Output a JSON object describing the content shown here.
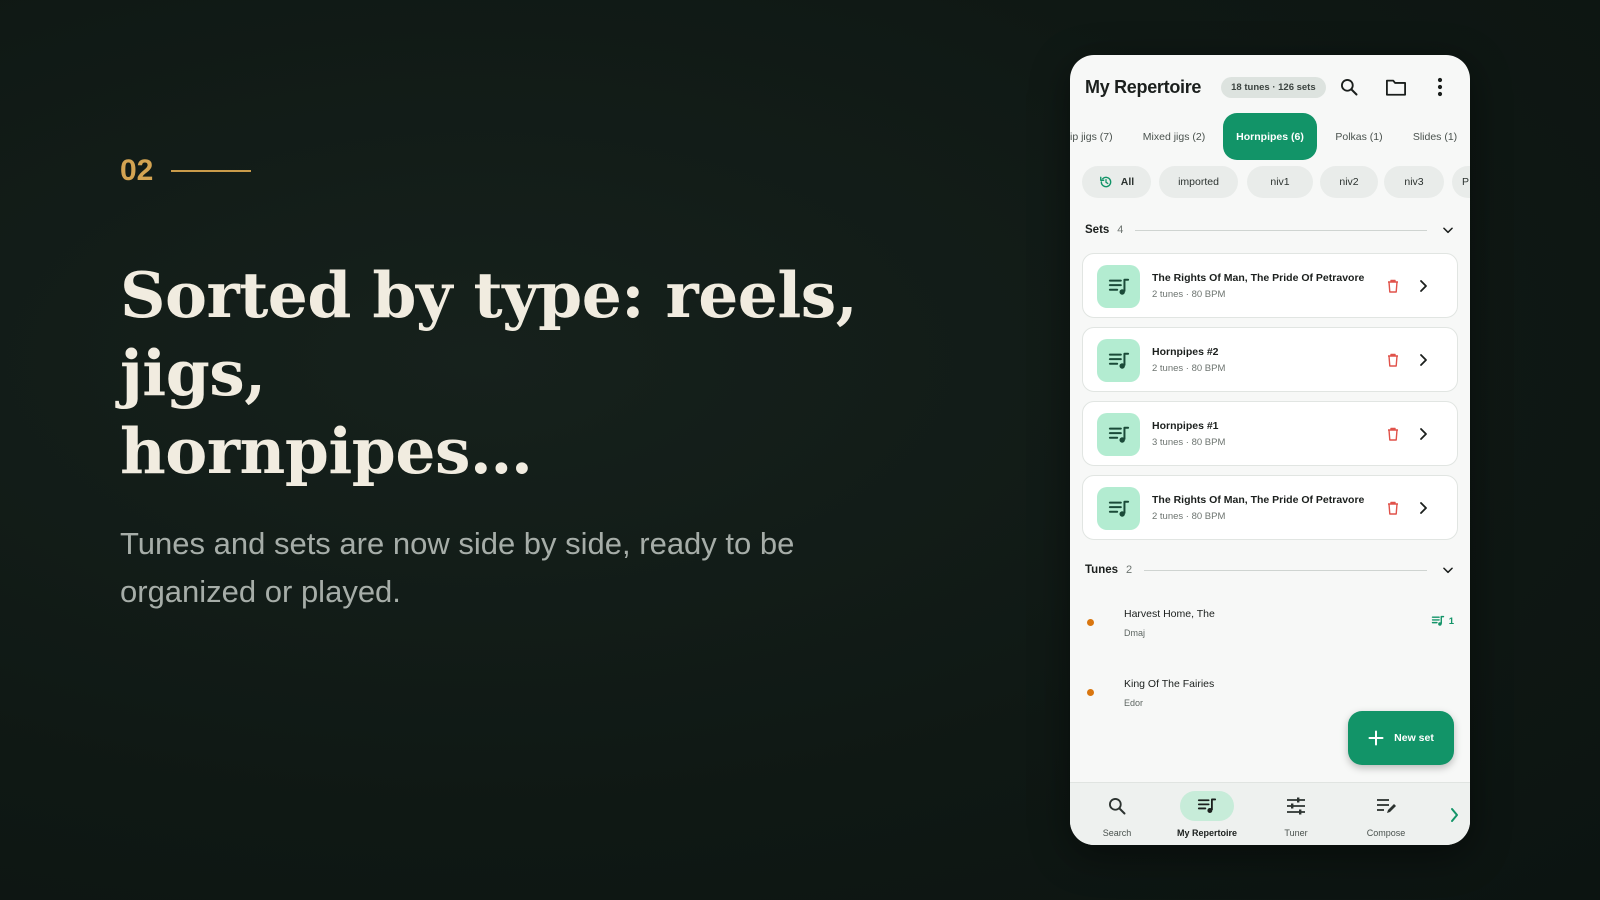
{
  "hero": {
    "step": "02",
    "headline_line1": "Sorted by type: reels, jigs,",
    "headline_line2": "hornpipes…",
    "subline_line1": "Tunes and sets are now side by side, ready to be",
    "subline_line2": "organized or played."
  },
  "colors": {
    "accent_gold": "#d4a452",
    "brand_green": "#129468",
    "set_icon_bg": "#b3ecd1",
    "delete_red": "#e0524a",
    "dot_orange": "#d9760f"
  },
  "app": {
    "title": "My Repertoire",
    "count_badge": "18 tunes · 126 sets",
    "icons": [
      "search-icon",
      "folder-icon",
      "more-vert-icon"
    ]
  },
  "tabs": [
    {
      "label": "ip jigs (7)"
    },
    {
      "label": "Mixed jigs (2)"
    },
    {
      "label": "Hornpipes (6)",
      "active": true
    },
    {
      "label": "Polkas (1)"
    },
    {
      "label": "Slides (1)"
    }
  ],
  "chips": [
    {
      "label": "All",
      "icon": "history-icon",
      "selected": true
    },
    {
      "label": "imported"
    },
    {
      "label": "niv1"
    },
    {
      "label": "niv2"
    },
    {
      "label": "niv3"
    },
    {
      "label": "P"
    }
  ],
  "sets_section": {
    "label": "Sets",
    "count": "4",
    "items": [
      {
        "title": "The Rights Of Man, The Pride Of Petravore",
        "meta": "2 tunes · 80 BPM"
      },
      {
        "title": "Hornpipes #2",
        "meta": "2 tunes · 80 BPM"
      },
      {
        "title": "Hornpipes #1",
        "meta": "3 tunes · 80 BPM"
      },
      {
        "title": "The Rights Of Man, The Pride Of Petravore",
        "meta": "2 tunes · 80 BPM"
      }
    ]
  },
  "tunes_section": {
    "label": "Tunes",
    "count": "2",
    "items": [
      {
        "name": "Harvest Home, The",
        "key": "Dmaj",
        "set_count": "1"
      },
      {
        "name": "King Of The Fairies",
        "key": "Edor",
        "set_count": ""
      }
    ]
  },
  "fab": {
    "label": "New set",
    "icon": "plus-icon"
  },
  "bottom_nav": [
    {
      "label": "Search",
      "icon": "search-icon"
    },
    {
      "label": "My Repertoire",
      "icon": "playlist-music-icon",
      "active": true
    },
    {
      "label": "Tuner",
      "icon": "tune-sliders-icon"
    },
    {
      "label": "Compose",
      "icon": "edit-note-icon"
    }
  ]
}
